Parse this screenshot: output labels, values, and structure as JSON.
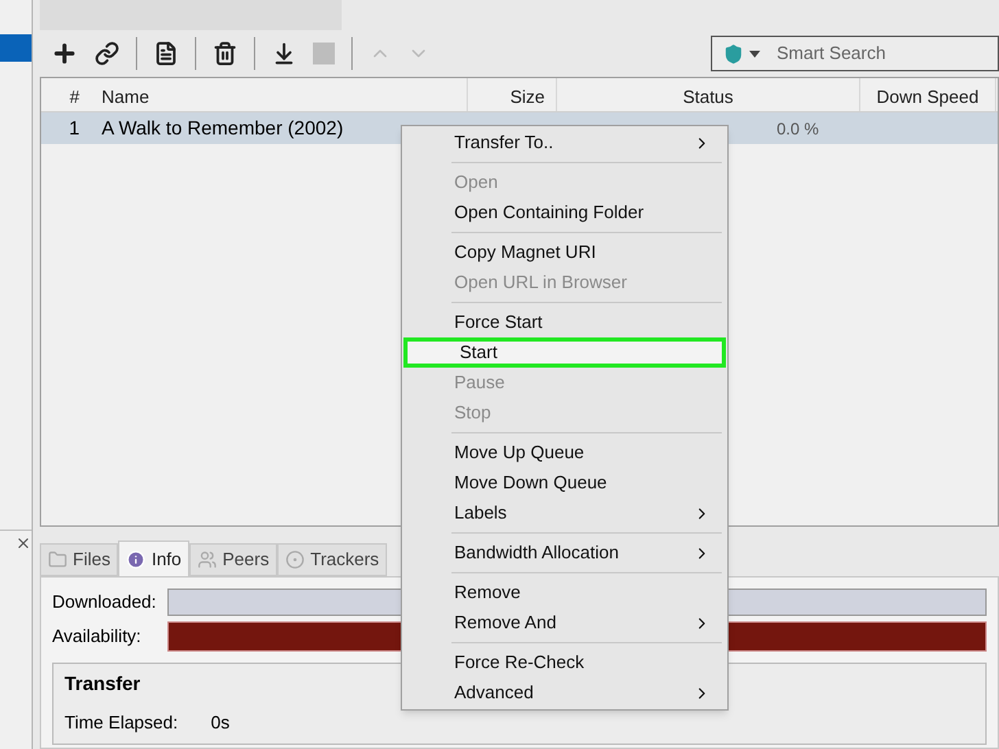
{
  "toolbar": {
    "search": {
      "placeholder": "Smart Search"
    }
  },
  "table": {
    "columns": [
      "#",
      "Name",
      "Size",
      "Status",
      "Down Speed"
    ],
    "rows": [
      {
        "number": "1",
        "name": "A Walk to Remember (2002)",
        "status": "0.0 %",
        "selected": true
      }
    ]
  },
  "details": {
    "tabs": [
      {
        "label": "Files",
        "selected": false
      },
      {
        "label": "Info",
        "selected": true
      },
      {
        "label": "Peers",
        "selected": false
      },
      {
        "label": "Trackers",
        "selected": false
      }
    ],
    "downloaded_label": "Downloaded:",
    "availability_label": "Availability:",
    "transfer_title": "Transfer",
    "time_elapsed_label": "Time Elapsed:",
    "time_elapsed_value": "0s"
  },
  "context_menu": [
    {
      "kind": "item",
      "label": "Transfer To..",
      "disabled": false,
      "submenu": true,
      "selected": false
    },
    {
      "kind": "separator"
    },
    {
      "kind": "item",
      "label": "Open",
      "disabled": true,
      "submenu": false,
      "selected": false
    },
    {
      "kind": "item",
      "label": "Open Containing Folder",
      "disabled": false,
      "submenu": false,
      "selected": false
    },
    {
      "kind": "separator"
    },
    {
      "kind": "item",
      "label": "Copy Magnet URI",
      "disabled": false,
      "submenu": false,
      "selected": false
    },
    {
      "kind": "item",
      "label": "Open URL in Browser",
      "disabled": true,
      "submenu": false,
      "selected": false
    },
    {
      "kind": "separator"
    },
    {
      "kind": "item",
      "label": "Force Start",
      "disabled": false,
      "submenu": false,
      "selected": false
    },
    {
      "kind": "item",
      "label": "Start",
      "disabled": false,
      "submenu": false,
      "selected": true
    },
    {
      "kind": "item",
      "label": "Pause",
      "disabled": true,
      "submenu": false,
      "selected": false
    },
    {
      "kind": "item",
      "label": "Stop",
      "disabled": true,
      "submenu": false,
      "selected": false
    },
    {
      "kind": "separator"
    },
    {
      "kind": "item",
      "label": "Move Up Queue",
      "disabled": false,
      "submenu": false,
      "selected": false
    },
    {
      "kind": "item",
      "label": "Move Down Queue",
      "disabled": false,
      "submenu": false,
      "selected": false
    },
    {
      "kind": "item",
      "label": "Labels",
      "disabled": false,
      "submenu": true,
      "selected": false
    },
    {
      "kind": "separator"
    },
    {
      "kind": "item",
      "label": "Bandwidth Allocation",
      "disabled": false,
      "submenu": true,
      "selected": false
    },
    {
      "kind": "separator"
    },
    {
      "kind": "item",
      "label": "Remove",
      "disabled": false,
      "submenu": false,
      "selected": false
    },
    {
      "kind": "item",
      "label": "Remove And",
      "disabled": false,
      "submenu": true,
      "selected": false
    },
    {
      "kind": "separator"
    },
    {
      "kind": "item",
      "label": "Force Re-Check",
      "disabled": false,
      "submenu": false,
      "selected": false
    },
    {
      "kind": "item",
      "label": "Advanced",
      "disabled": false,
      "submenu": true,
      "selected": false
    }
  ]
}
